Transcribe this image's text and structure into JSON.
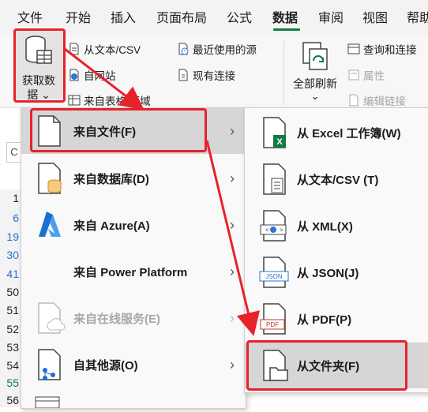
{
  "tabs": [
    "文件",
    "开始",
    "插入",
    "页面布局",
    "公式",
    "数据",
    "审阅",
    "视图",
    "帮助"
  ],
  "ribbon": {
    "get_data_label_line1": "获取数",
    "get_data_label_line2": "据 ⌄",
    "from_text_csv": "从文本/CSV",
    "from_web": "自网站",
    "from_table": "来自表格/区域",
    "recent_sources": "最近使用的源",
    "existing_connections": "现有连接",
    "refresh_all_line1": "全部刷新",
    "refresh_all_line2": "⌄",
    "queries_connections": "查询和连接",
    "properties": "属性",
    "edit_links": "编辑链接"
  },
  "namebox": "C",
  "row_headers": [
    "1",
    "6",
    "19",
    "30",
    "41",
    "50",
    "51",
    "52",
    "53",
    "54",
    "55",
    "56"
  ],
  "menu1": [
    {
      "label": "来自文件(F)",
      "icon": "file-icon",
      "arrow": "›",
      "disabled": false
    },
    {
      "label": "来自数据库(D)",
      "icon": "database-icon",
      "arrow": "›",
      "disabled": false
    },
    {
      "label": "来自 Azure(A)",
      "icon": "azure-icon",
      "arrow": "›",
      "disabled": false
    },
    {
      "label": "来自 Power Platform",
      "icon": "",
      "arrow": "›",
      "disabled": false
    },
    {
      "label": "来自在线服务(E)",
      "icon": "cloud-file-icon",
      "arrow": "›",
      "disabled": true
    },
    {
      "label": "自其他源(O)",
      "icon": "other-source-icon",
      "arrow": "›",
      "disabled": false
    }
  ],
  "menu2": [
    {
      "label": "从 Excel 工作簿(W)",
      "icon": "excel-file-icon"
    },
    {
      "label": "从文本/CSV (T)",
      "icon": "text-file-icon"
    },
    {
      "label": "从 XML(X)",
      "icon": "xml-file-icon"
    },
    {
      "label": "从 JSON(J)",
      "icon": "json-file-icon"
    },
    {
      "label": "从 PDF(P)",
      "icon": "pdf-file-icon"
    },
    {
      "label": "从文件夹(F)",
      "icon": "folder-file-icon"
    }
  ],
  "colors": {
    "accent": "#107c41",
    "highlight_box": "#e8222a",
    "row_highlight": "#d6d6d6"
  }
}
